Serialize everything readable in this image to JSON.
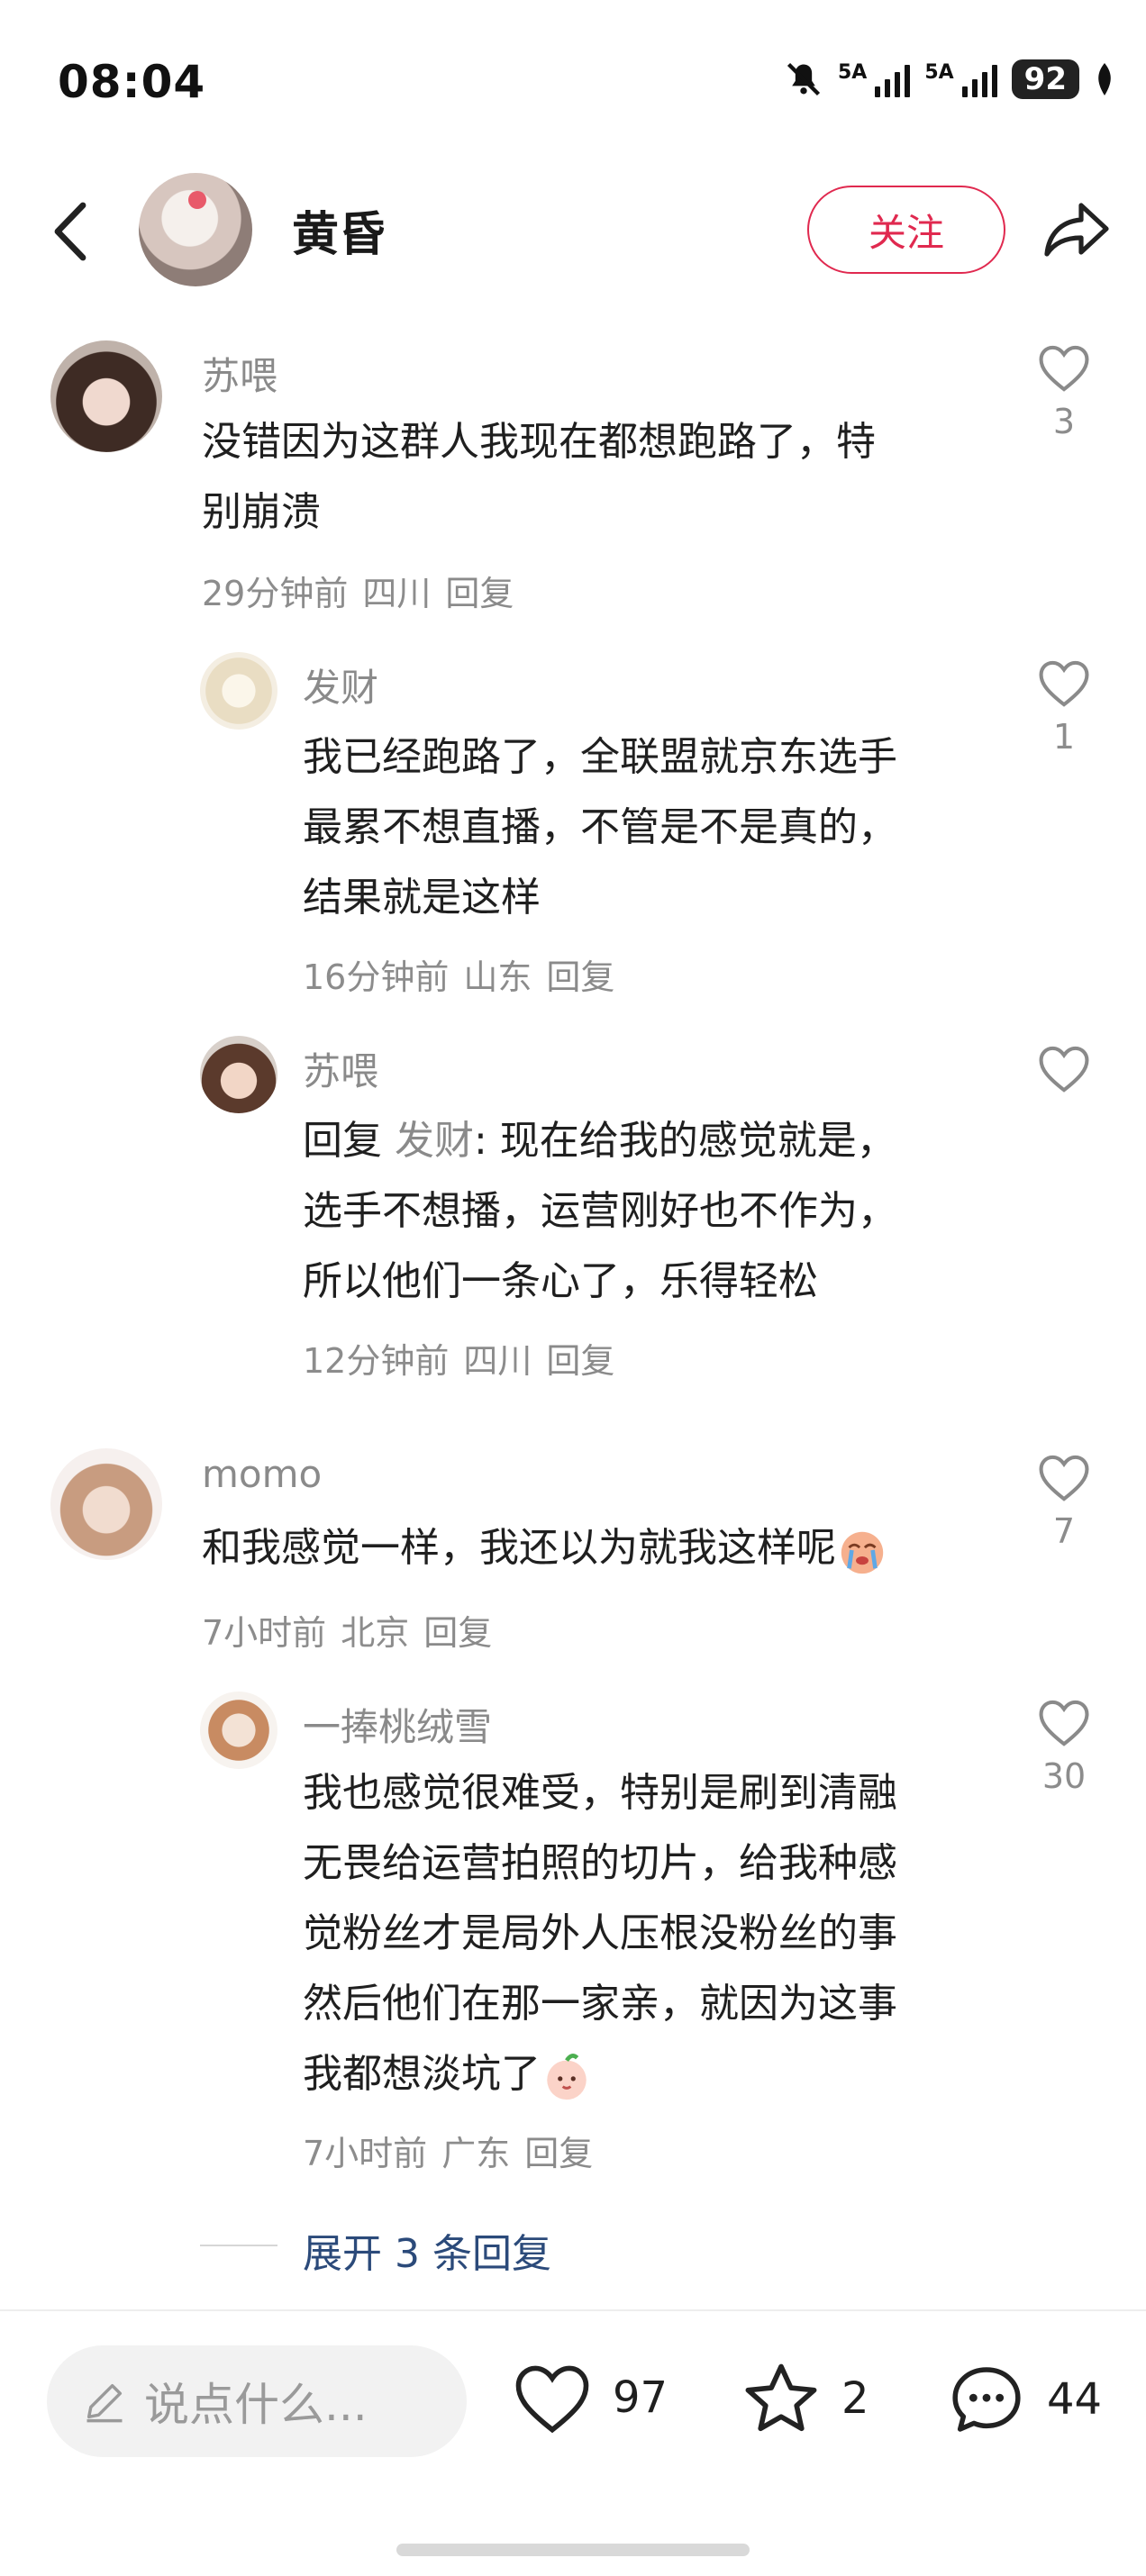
{
  "status_bar": {
    "time": "08:04",
    "signal1_label": "5A",
    "signal2_label": "5A",
    "battery": "92"
  },
  "header": {
    "title": "黄昏",
    "follow_label": "关注"
  },
  "comments": [
    {
      "user": "苏喂",
      "text_line1": "没错因为这群人我现在都想跑路了，特",
      "text_line2": "别崩溃",
      "time": "29分钟前",
      "location": "四川",
      "reply": "回复",
      "likes": "3"
    },
    {
      "user": "发财",
      "text_line1": "我已经跑路了，全联盟就京东选手",
      "text_line2": "最累不想直播，不管是不是真的，",
      "text_line3": "结果就是这样",
      "time": "16分钟前",
      "location": "山东",
      "reply": "回复",
      "likes": "1"
    },
    {
      "user": "苏喂",
      "reply_prefix": "回复",
      "reply_to": "发财",
      "text_line1": ": 现在给我的感觉就是，",
      "text_line2": "选手不想播，运营刚好也不作为，",
      "text_line3": "所以他们一条心了，乐得轻松",
      "time": "12分钟前",
      "location": "四川",
      "reply": "回复",
      "likes": ""
    },
    {
      "user": "momo",
      "text_line1": "和我感觉一样，我还以为就我这样呢",
      "time": "7小时前",
      "location": "北京",
      "reply": "回复",
      "likes": "7"
    },
    {
      "user": "一捧桃绒雪",
      "text_line1": "我也感觉很难受，特别是刷到清融",
      "text_line2": "无畏给运营拍照的切片，给我种感",
      "text_line3": "觉粉丝才是局外人压根没粉丝的事",
      "text_line4": "然后他们在那一家亲，就因为这事",
      "text_line5": "我都想淡坑了",
      "time": "7小时前",
      "location": "广东",
      "reply": "回复",
      "likes": "30"
    }
  ],
  "expand_replies": "展开 3 条回复",
  "bottom_bar": {
    "input_placeholder": "说点什么...",
    "likes": "97",
    "favorites": "2",
    "comments": "44"
  }
}
